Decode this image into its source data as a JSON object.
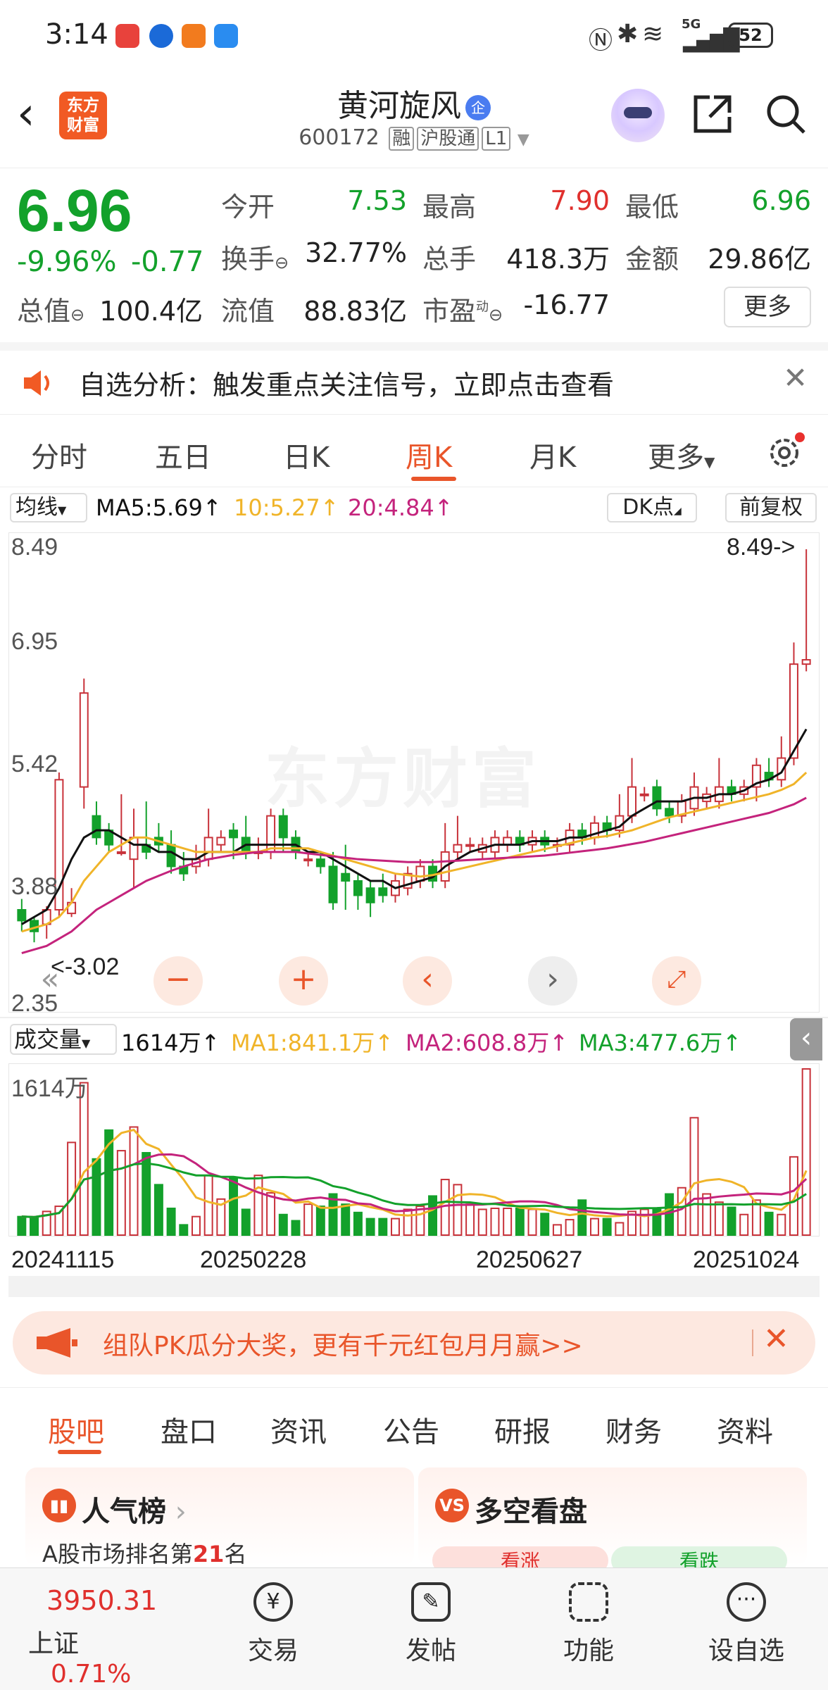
{
  "status_bar": {
    "time": "3:14",
    "battery": "52",
    "network": "5G"
  },
  "header": {
    "back": "‹",
    "logo": "东方财富",
    "stock_name": "黄河旋风",
    "stock_tag": "企",
    "stock_code": "600172",
    "tags": [
      "融",
      "沪股通",
      "L1"
    ]
  },
  "quote": {
    "price": "6.96",
    "change_pct": "-9.96%",
    "change_abs": "-0.77",
    "open_label": "今开",
    "open": "7.53",
    "high_label": "最高",
    "high": "7.90",
    "low_label": "最低",
    "low": "6.96",
    "turnover_label": "换手",
    "turnover": "32.77%",
    "volume_label": "总手",
    "volume": "418.3万",
    "amount_label": "金额",
    "amount": "29.86亿",
    "mktcap_label": "总值",
    "mktcap": "100.4亿",
    "float_label": "流值",
    "float_cap": "88.83亿",
    "pe_label": "市盈",
    "pe_sup": "动",
    "pe": "-16.77",
    "more": "更多"
  },
  "alert": {
    "text": "自选分析：触发重点关注信号，立即点击查看"
  },
  "k_tabs": {
    "items": [
      "分时",
      "五日",
      "日K",
      "周K",
      "月K",
      "更多"
    ],
    "active": "周K"
  },
  "indicators": {
    "ma_type": "均线",
    "ma5": "MA5:5.69↑",
    "ma10": "10:5.27↑",
    "ma20": "20:4.84↑",
    "dk": "DK点",
    "adjust": "前复权"
  },
  "price_axis": {
    "top": "8.49",
    "t2": "6.95",
    "t3": "5.42",
    "t4": "3.88",
    "bottom": "2.35",
    "max_marker": "8.49->",
    "min_marker": "<-3.02"
  },
  "volume": {
    "label": "成交量",
    "current": "1614万↑",
    "ma1": "MA1:841.1万↑",
    "ma2": "MA2:608.8万↑",
    "ma3": "MA3:477.6万↑",
    "axis_top": "1614万"
  },
  "dates": [
    "20241115",
    "20250228",
    "20250627",
    "20251024"
  ],
  "watermark": "东方财富",
  "colors": {
    "up": "#c8323a",
    "down": "#13a12b",
    "accent": "#e9552a",
    "ma5": "#111111",
    "ma10": "#f0b429",
    "ma20": "#c4237c"
  },
  "chart_data": {
    "type": "candlestick",
    "ylim": [
      2.35,
      8.49
    ],
    "candles": [
      [
        3.5,
        3.35,
        3.65,
        3.2
      ],
      [
        3.35,
        3.2,
        3.4,
        3.05
      ],
      [
        3.3,
        3.5,
        3.55,
        3.1
      ],
      [
        3.5,
        5.3,
        5.4,
        3.4
      ],
      [
        3.45,
        3.6,
        3.8,
        3.4
      ],
      [
        5.2,
        6.5,
        6.7,
        4.9
      ],
      [
        4.8,
        4.5,
        5.0,
        4.4
      ],
      [
        4.6,
        4.4,
        4.7,
        4.3
      ],
      [
        4.3,
        4.3,
        5.1,
        4.25
      ],
      [
        4.2,
        4.5,
        4.9,
        3.8
      ],
      [
        4.4,
        4.3,
        5.0,
        4.2
      ],
      [
        4.5,
        4.4,
        4.7,
        4.3
      ],
      [
        4.4,
        4.1,
        4.6,
        4.0
      ],
      [
        4.1,
        4.0,
        4.3,
        3.9
      ],
      [
        4.1,
        4.2,
        4.4,
        4.0
      ],
      [
        4.2,
        4.5,
        4.9,
        4.1
      ],
      [
        4.4,
        4.5,
        4.6,
        4.3
      ],
      [
        4.6,
        4.5,
        4.7,
        4.2
      ],
      [
        4.5,
        4.3,
        4.8,
        4.2
      ],
      [
        4.3,
        4.3,
        4.5,
        4.2
      ],
      [
        4.3,
        4.8,
        4.9,
        4.2
      ],
      [
        4.8,
        4.5,
        4.9,
        4.3
      ],
      [
        4.5,
        4.3,
        4.6,
        4.2
      ],
      [
        4.2,
        4.2,
        4.3,
        4.1
      ],
      [
        4.2,
        4.1,
        4.3,
        4.0
      ],
      [
        4.1,
        3.6,
        4.3,
        3.5
      ],
      [
        4.0,
        3.9,
        4.4,
        3.5
      ],
      [
        3.9,
        3.7,
        4.0,
        3.5
      ],
      [
        3.8,
        3.6,
        3.9,
        3.4
      ],
      [
        3.8,
        3.7,
        4.0,
        3.6
      ],
      [
        3.7,
        3.9,
        4.0,
        3.6
      ],
      [
        3.8,
        4.0,
        4.1,
        3.7
      ],
      [
        3.9,
        4.1,
        4.2,
        3.8
      ],
      [
        4.1,
        3.9,
        4.2,
        3.8
      ],
      [
        3.9,
        4.3,
        4.7,
        3.8
      ],
      [
        4.3,
        4.4,
        4.8,
        4.2
      ],
      [
        4.4,
        4.4,
        4.5,
        4.3
      ],
      [
        4.3,
        4.4,
        4.5,
        4.2
      ],
      [
        4.3,
        4.5,
        4.6,
        4.2
      ],
      [
        4.4,
        4.5,
        4.6,
        4.3
      ],
      [
        4.5,
        4.4,
        4.6,
        4.3
      ],
      [
        4.4,
        4.5,
        4.6,
        4.3
      ],
      [
        4.5,
        4.4,
        4.6,
        4.3
      ],
      [
        4.4,
        4.4,
        4.5,
        4.3
      ],
      [
        4.4,
        4.6,
        4.7,
        4.3
      ],
      [
        4.6,
        4.5,
        4.7,
        4.4
      ],
      [
        4.5,
        4.7,
        4.8,
        4.4
      ],
      [
        4.7,
        4.6,
        4.8,
        4.5
      ],
      [
        4.6,
        4.8,
        5.1,
        4.5
      ],
      [
        4.8,
        5.2,
        5.6,
        4.7
      ],
      [
        5.1,
        5.1,
        5.2,
        5.0
      ],
      [
        5.2,
        4.9,
        5.3,
        4.8
      ],
      [
        4.9,
        4.8,
        5.0,
        4.7
      ],
      [
        4.8,
        5.0,
        5.1,
        4.7
      ],
      [
        4.9,
        5.2,
        5.4,
        4.8
      ],
      [
        5.0,
        5.1,
        5.2,
        4.9
      ],
      [
        5.0,
        5.2,
        5.6,
        4.9
      ],
      [
        5.2,
        5.1,
        5.3,
        5.0
      ],
      [
        5.1,
        5.2,
        5.3,
        5.0
      ],
      [
        5.2,
        5.5,
        5.6,
        5.0
      ],
      [
        5.4,
        5.3,
        5.6,
        5.2
      ],
      [
        5.3,
        5.6,
        5.9,
        5.2
      ],
      [
        5.6,
        6.9,
        7.2,
        5.5
      ],
      [
        6.9,
        6.96,
        8.49,
        6.8
      ]
    ],
    "ma5": [
      3.3,
      3.4,
      3.5,
      3.8,
      4.2,
      4.5,
      4.6,
      4.6,
      4.5,
      4.4,
      4.4,
      4.3,
      4.3,
      4.2,
      4.2,
      4.3,
      4.3,
      4.3,
      4.4,
      4.4,
      4.4,
      4.4,
      4.4,
      4.3,
      4.3,
      4.2,
      4.1,
      4.0,
      3.9,
      3.9,
      3.8,
      3.85,
      3.9,
      3.95,
      4.1,
      4.2,
      4.3,
      4.35,
      4.4,
      4.4,
      4.4,
      4.45,
      4.45,
      4.45,
      4.5,
      4.5,
      4.55,
      4.6,
      4.65,
      4.8,
      4.9,
      5.0,
      5.0,
      5.0,
      5.05,
      5.05,
      5.1,
      5.1,
      5.15,
      5.25,
      5.3,
      5.4,
      5.7,
      6.0
    ],
    "ma10": [
      3.2,
      3.25,
      3.3,
      3.4,
      3.6,
      3.9,
      4.1,
      4.3,
      4.4,
      4.5,
      4.5,
      4.45,
      4.4,
      4.35,
      4.3,
      4.3,
      4.3,
      4.3,
      4.3,
      4.3,
      4.35,
      4.35,
      4.35,
      4.35,
      4.3,
      4.25,
      4.2,
      4.15,
      4.1,
      4.05,
      4.0,
      3.98,
      3.96,
      3.98,
      4.02,
      4.06,
      4.1,
      4.14,
      4.18,
      4.22,
      4.26,
      4.3,
      4.34,
      4.38,
      4.42,
      4.46,
      4.5,
      4.52,
      4.56,
      4.6,
      4.66,
      4.72,
      4.78,
      4.82,
      4.86,
      4.9,
      4.94,
      4.98,
      5.02,
      5.06,
      5.1,
      5.16,
      5.24,
      5.4
    ],
    "ma20": [
      2.9,
      2.95,
      3.0,
      3.1,
      3.2,
      3.35,
      3.5,
      3.6,
      3.7,
      3.8,
      3.9,
      3.97,
      4.04,
      4.1,
      4.15,
      4.2,
      4.23,
      4.26,
      4.28,
      4.3,
      4.3,
      4.3,
      4.3,
      4.28,
      4.26,
      4.24,
      4.22,
      4.2,
      4.19,
      4.18,
      4.17,
      4.16,
      4.16,
      4.16,
      4.17,
      4.18,
      4.19,
      4.2,
      4.21,
      4.22,
      4.23,
      4.24,
      4.25,
      4.27,
      4.29,
      4.31,
      4.33,
      4.35,
      4.38,
      4.41,
      4.44,
      4.48,
      4.52,
      4.56,
      4.6,
      4.64,
      4.68,
      4.72,
      4.76,
      4.8,
      4.84,
      4.9,
      4.96,
      5.05
    ],
    "volume": [
      180,
      170,
      230,
      280,
      900,
      1480,
      740,
      1020,
      820,
      1050,
      800,
      490,
      260,
      100,
      180,
      580,
      350,
      560,
      250,
      580,
      410,
      200,
      140,
      300,
      280,
      400,
      300,
      220,
      160,
      160,
      160,
      250,
      280,
      380,
      540,
      490,
      300,
      250,
      260,
      260,
      260,
      250,
      210,
      100,
      150,
      340,
      160,
      160,
      120,
      230,
      250,
      260,
      400,
      460,
      1140,
      400,
      320,
      270,
      200,
      340,
      220,
      200,
      760,
      1614
    ]
  }
}
